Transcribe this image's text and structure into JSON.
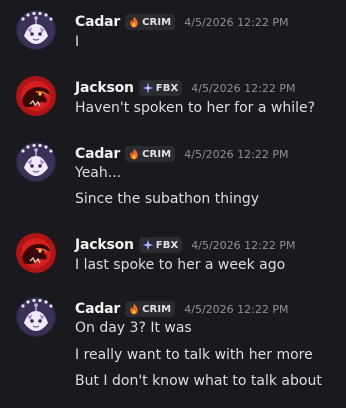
{
  "messages": [
    {
      "author": "Cadar",
      "tag": "CRIM",
      "tag_icon": "fire-icon",
      "timestamp": "4/5/2026 12:22 PM",
      "lines": [
        "I"
      ]
    },
    {
      "author": "Jackson",
      "tag": "FBX",
      "tag_icon": "sparkle-icon",
      "timestamp": "4/5/2026 12:22 PM",
      "lines": [
        "Haven't spoken to her for a while?"
      ]
    },
    {
      "author": "Cadar",
      "tag": "CRIM",
      "tag_icon": "fire-icon",
      "timestamp": "4/5/2026 12:22 PM",
      "lines": [
        "Yeah...",
        "Since the subathon thingy"
      ]
    },
    {
      "author": "Jackson",
      "tag": "FBX",
      "tag_icon": "sparkle-icon",
      "timestamp": "4/5/2026 12:22 PM",
      "lines": [
        "I last spoke to her a week ago"
      ]
    },
    {
      "author": "Cadar",
      "tag": "CRIM",
      "tag_icon": "fire-icon",
      "timestamp": "4/5/2026 12:22 PM",
      "lines": [
        "On day 3? It was",
        "I really want to talk with her more",
        "But I don't know what to talk about"
      ]
    }
  ],
  "colors": {
    "background": "#1a1a1e",
    "username": "#f2f3f5",
    "message_text": "#dbdee1",
    "timestamp": "#8d9098",
    "tag_background": "#2b2c31"
  }
}
